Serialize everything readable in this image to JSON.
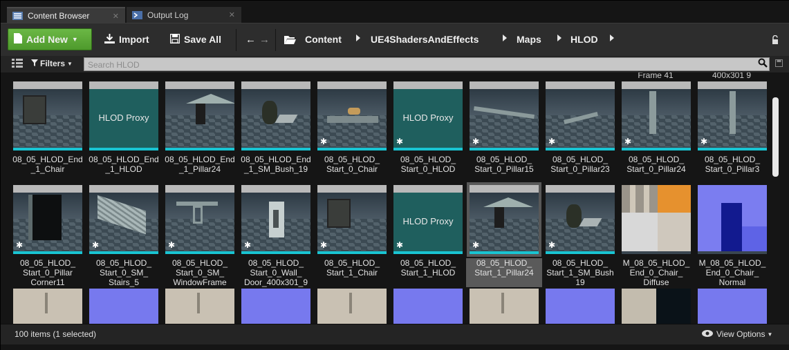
{
  "tabs": [
    {
      "label": "Content Browser",
      "active": true,
      "icon": "content-browser-icon"
    },
    {
      "label": "Output Log",
      "active": false,
      "icon": "output-log-icon"
    }
  ],
  "toolbar": {
    "add_new": "Add New",
    "import": "Import",
    "save_all": "Save All",
    "breadcrumb": [
      "Content",
      "UE4ShadersAndEffects",
      "Maps",
      "HLOD"
    ]
  },
  "filterbar": {
    "filters": "Filters",
    "search_placeholder": "Search HLOD"
  },
  "grid": {
    "top_cut_labels": [
      "Frame 41",
      "400x301 9"
    ],
    "row1": [
      {
        "label": "08_05_HLOD_End\n_1_Chair",
        "kind": "scene"
      },
      {
        "label": "08_05_HLOD_End\n_1_HLOD",
        "kind": "proxy",
        "proxy_text": "HLOD Proxy"
      },
      {
        "label": "08_05_HLOD_End\n_1_Pillar24",
        "kind": "scene"
      },
      {
        "label": "08_05_HLOD_End\n_1_SM_Bush_19",
        "kind": "scene"
      },
      {
        "label": "08_05_HLOD_\nStart_0_Chair",
        "kind": "scene",
        "star": true
      },
      {
        "label": "08_05_HLOD_\nStart_0_HLOD",
        "kind": "proxy",
        "proxy_text": "HLOD Proxy",
        "star": true
      },
      {
        "label": "08_05_HLOD_\nStart_0_Pillar15",
        "kind": "scene",
        "star": true
      },
      {
        "label": "08_05_HLOD_\nStart_0_Pillar23",
        "kind": "scene",
        "star": true
      },
      {
        "label": "08_05_HLOD_\nStart_0_Pillar24",
        "kind": "scene",
        "star": true
      },
      {
        "label": "08_05_HLOD_\nStart_0_Pillar3",
        "kind": "scene",
        "star": true
      }
    ],
    "row2": [
      {
        "label": "08_05_HLOD_\nStart_0_Pillar\nCorner11",
        "kind": "scene",
        "star": true
      },
      {
        "label": "08_05_HLOD_\nStart_0_SM_\nStairs_5",
        "kind": "scene",
        "star": true
      },
      {
        "label": "08_05_HLOD_\nStart_0_SM_\nWindowFrame",
        "kind": "scene",
        "star": true
      },
      {
        "label": "08_05_HLOD_\nStart_0_Wall_\nDoor_400x301_9",
        "kind": "scene",
        "star": true
      },
      {
        "label": "08_05_HLOD_\nStart_1_Chair",
        "kind": "scene",
        "star": true
      },
      {
        "label": "08_05_HLOD_\nStart_1_HLOD",
        "kind": "proxy",
        "proxy_text": "HLOD Proxy",
        "star": true
      },
      {
        "label": "08_05_HLOD_\nStart_1_Pillar24",
        "kind": "scene",
        "star": true,
        "selected": true
      },
      {
        "label": "08_05_HLOD_\nStart_1_SM_Bush\n19",
        "kind": "scene",
        "star": true
      },
      {
        "label": "M_08_05_HLOD_\nEnd_0_Chair_\nDiffuse",
        "kind": "diffuse"
      },
      {
        "label": "M_08_05_HLOD_\nEnd_0_Chair_\nNormal",
        "kind": "normal"
      }
    ],
    "row3": [
      "diffuse",
      "normal",
      "diffuse",
      "normal",
      "diffuse",
      "normal",
      "diffuse",
      "normal",
      "diffuse-dark",
      "normal"
    ]
  },
  "status": {
    "count": "100 items (1 selected)",
    "view_options": "View Options"
  },
  "colors": {
    "accent_green": "#5aa735",
    "selection_cyan": "#19c4d2",
    "proxy_teal": "#1f5f5e"
  }
}
